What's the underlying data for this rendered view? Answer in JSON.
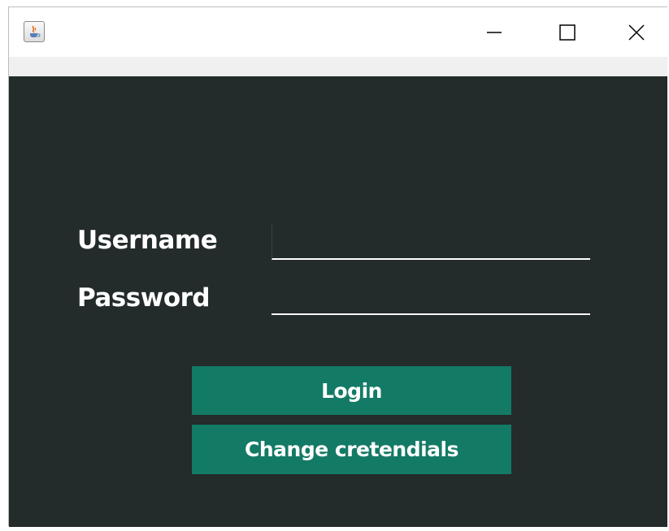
{
  "window": {
    "app_icon": "java-cup-icon",
    "controls": {
      "minimize_icon": "minimize-icon",
      "maximize_icon": "maximize-icon",
      "close_icon": "close-icon"
    }
  },
  "form": {
    "username_label": "Username",
    "password_label": "Password",
    "username_value": "",
    "password_value": ""
  },
  "buttons": {
    "login_label": "Login",
    "change_credentials_label": "Change cretendials"
  },
  "colors": {
    "background": "#232b2b",
    "button": "#137a65",
    "text": "#ffffff"
  }
}
